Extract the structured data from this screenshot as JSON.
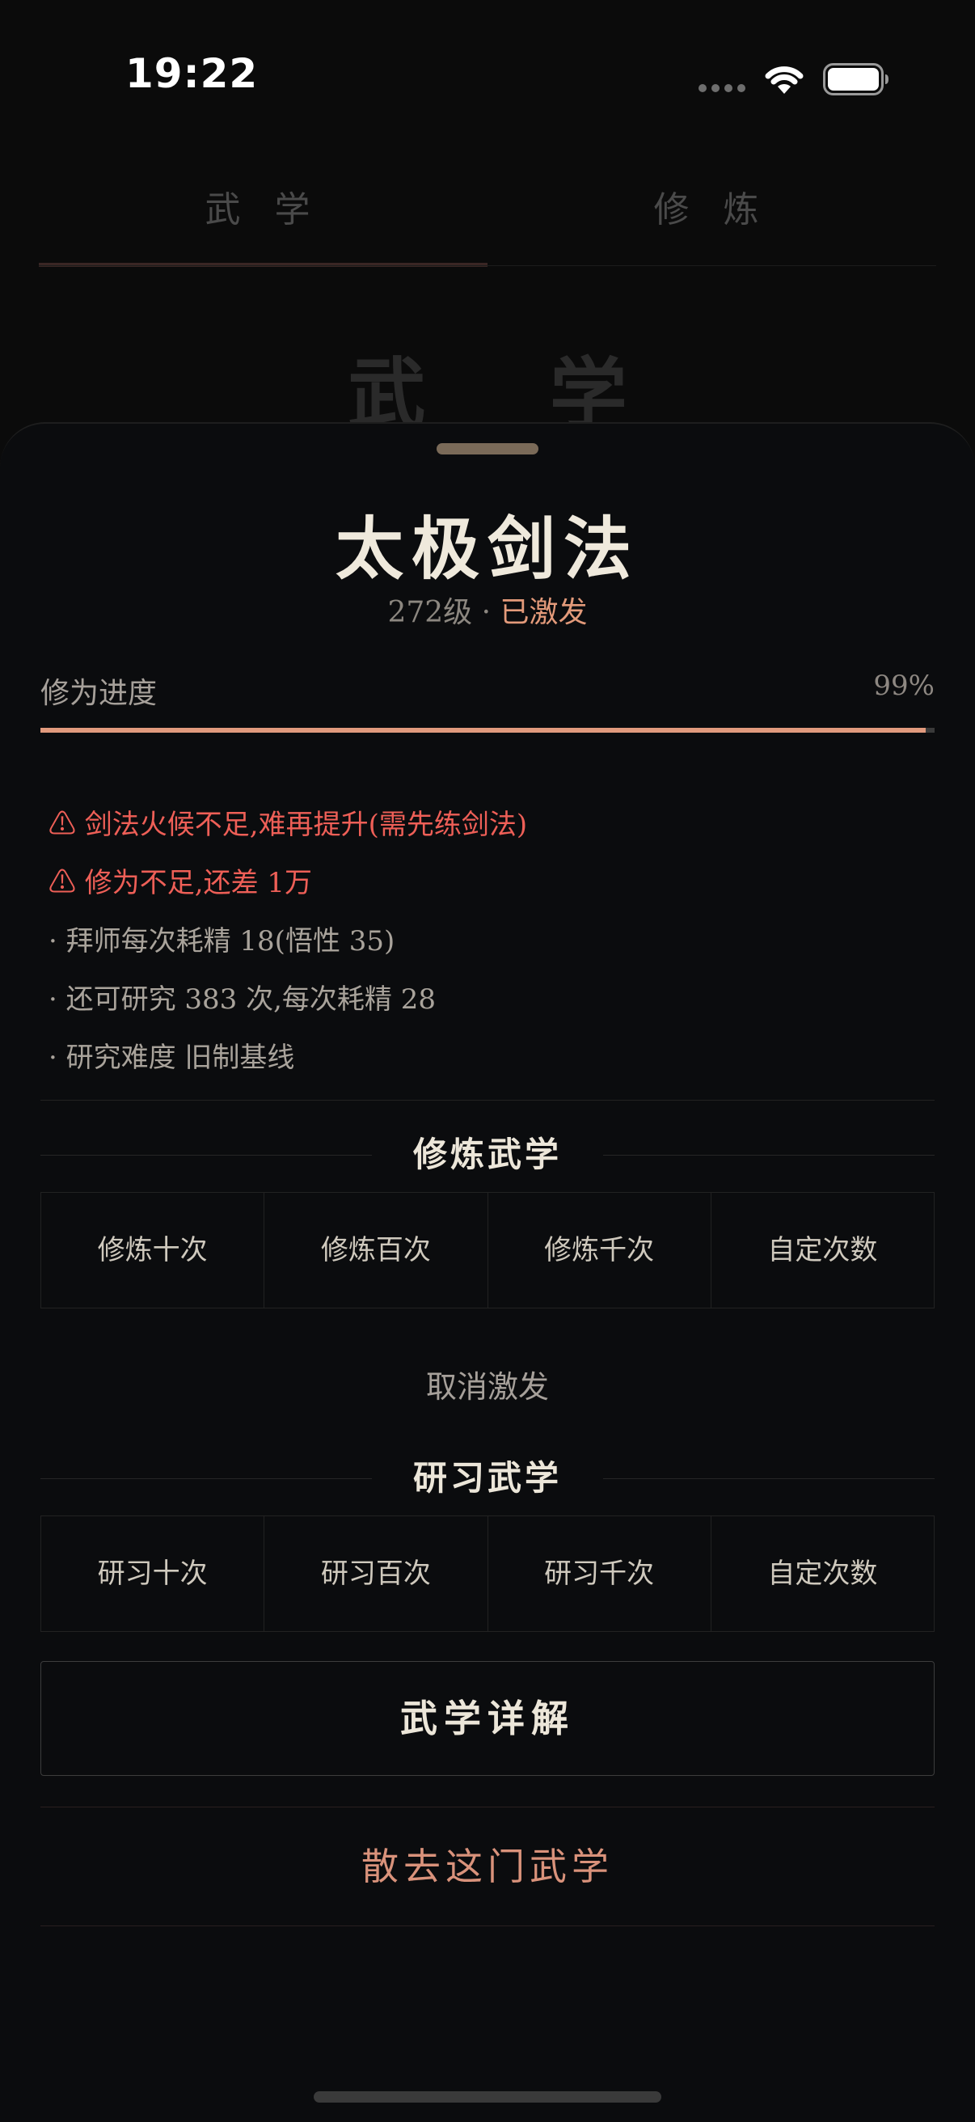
{
  "status_bar": {
    "time": "19:22",
    "icons": [
      "cellular-dots-icon",
      "wifi-icon",
      "battery-icon"
    ]
  },
  "tabs": [
    {
      "label": "武 学",
      "active": true
    },
    {
      "label": "修 炼",
      "active": false
    }
  ],
  "background_heading": "武 学",
  "sheet": {
    "title": "太极剑法",
    "level": "272级",
    "separator": " · ",
    "state": "已激发",
    "progress": {
      "label": "修为进度",
      "value_text": "99%",
      "percent": 99
    },
    "notes": [
      {
        "text": "⚠ 剑法火候不足,难再提升(需先练剑法)",
        "type": "warning"
      },
      {
        "text": "⚠ 修为不足,还差 1万",
        "type": "warning"
      },
      {
        "text": "· 拜师每次耗精 18(悟性 35)",
        "type": "info"
      },
      {
        "text": "· 还可研究 383 次,每次耗精 28",
        "type": "info"
      },
      {
        "text": "· 研究难度 旧制基线",
        "type": "info"
      }
    ],
    "train_section": {
      "title": "修炼武学",
      "buttons": [
        "修炼十次",
        "修炼百次",
        "修炼千次",
        "自定次数"
      ]
    },
    "cancel_action": "取消激发",
    "study_section": {
      "title": "研习武学",
      "buttons": [
        "研习十次",
        "研习百次",
        "研习千次",
        "自定次数"
      ]
    },
    "detail_button": "武学详解",
    "dismiss_action": "散去这门武学"
  },
  "colors": {
    "accent": "#e19a7d",
    "warning": "#ee5f57",
    "sheet_bg": "#0b0c0e"
  }
}
